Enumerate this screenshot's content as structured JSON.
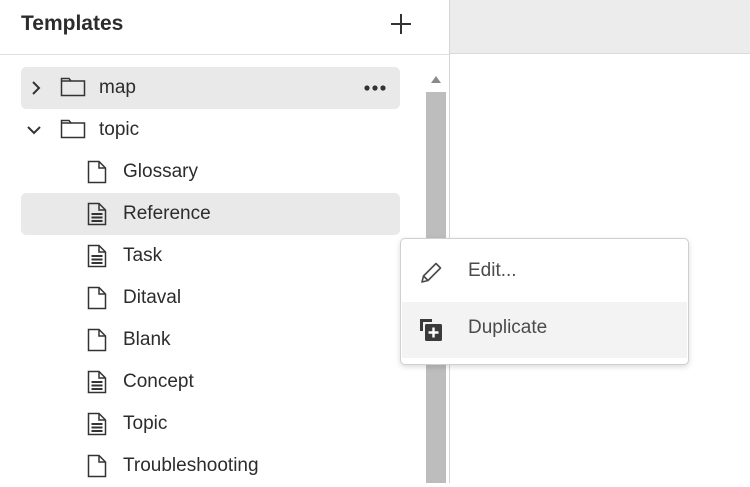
{
  "panel": {
    "title": "Templates",
    "add_icon": "plus-icon"
  },
  "tree": {
    "folders": [
      {
        "label": "map",
        "expanded": false,
        "selected": true
      },
      {
        "label": "topic",
        "expanded": true,
        "selected": false
      }
    ],
    "files": [
      {
        "label": "Glossary",
        "icon": "file-blank-icon"
      },
      {
        "label": "Reference",
        "icon": "file-lines-icon",
        "selected": true
      },
      {
        "label": "Task",
        "icon": "file-lines-icon"
      },
      {
        "label": "Ditaval",
        "icon": "file-blank-icon"
      },
      {
        "label": "Blank",
        "icon": "file-blank-icon"
      },
      {
        "label": "Concept",
        "icon": "file-lines-icon"
      },
      {
        "label": "Topic",
        "icon": "file-lines-icon"
      },
      {
        "label": "Troubleshooting",
        "icon": "file-blank-icon"
      }
    ]
  },
  "context_menu": {
    "items": [
      {
        "label": "Edit...",
        "icon": "pencil-icon"
      },
      {
        "label": "Duplicate",
        "icon": "duplicate-icon",
        "hovered": true
      }
    ]
  }
}
